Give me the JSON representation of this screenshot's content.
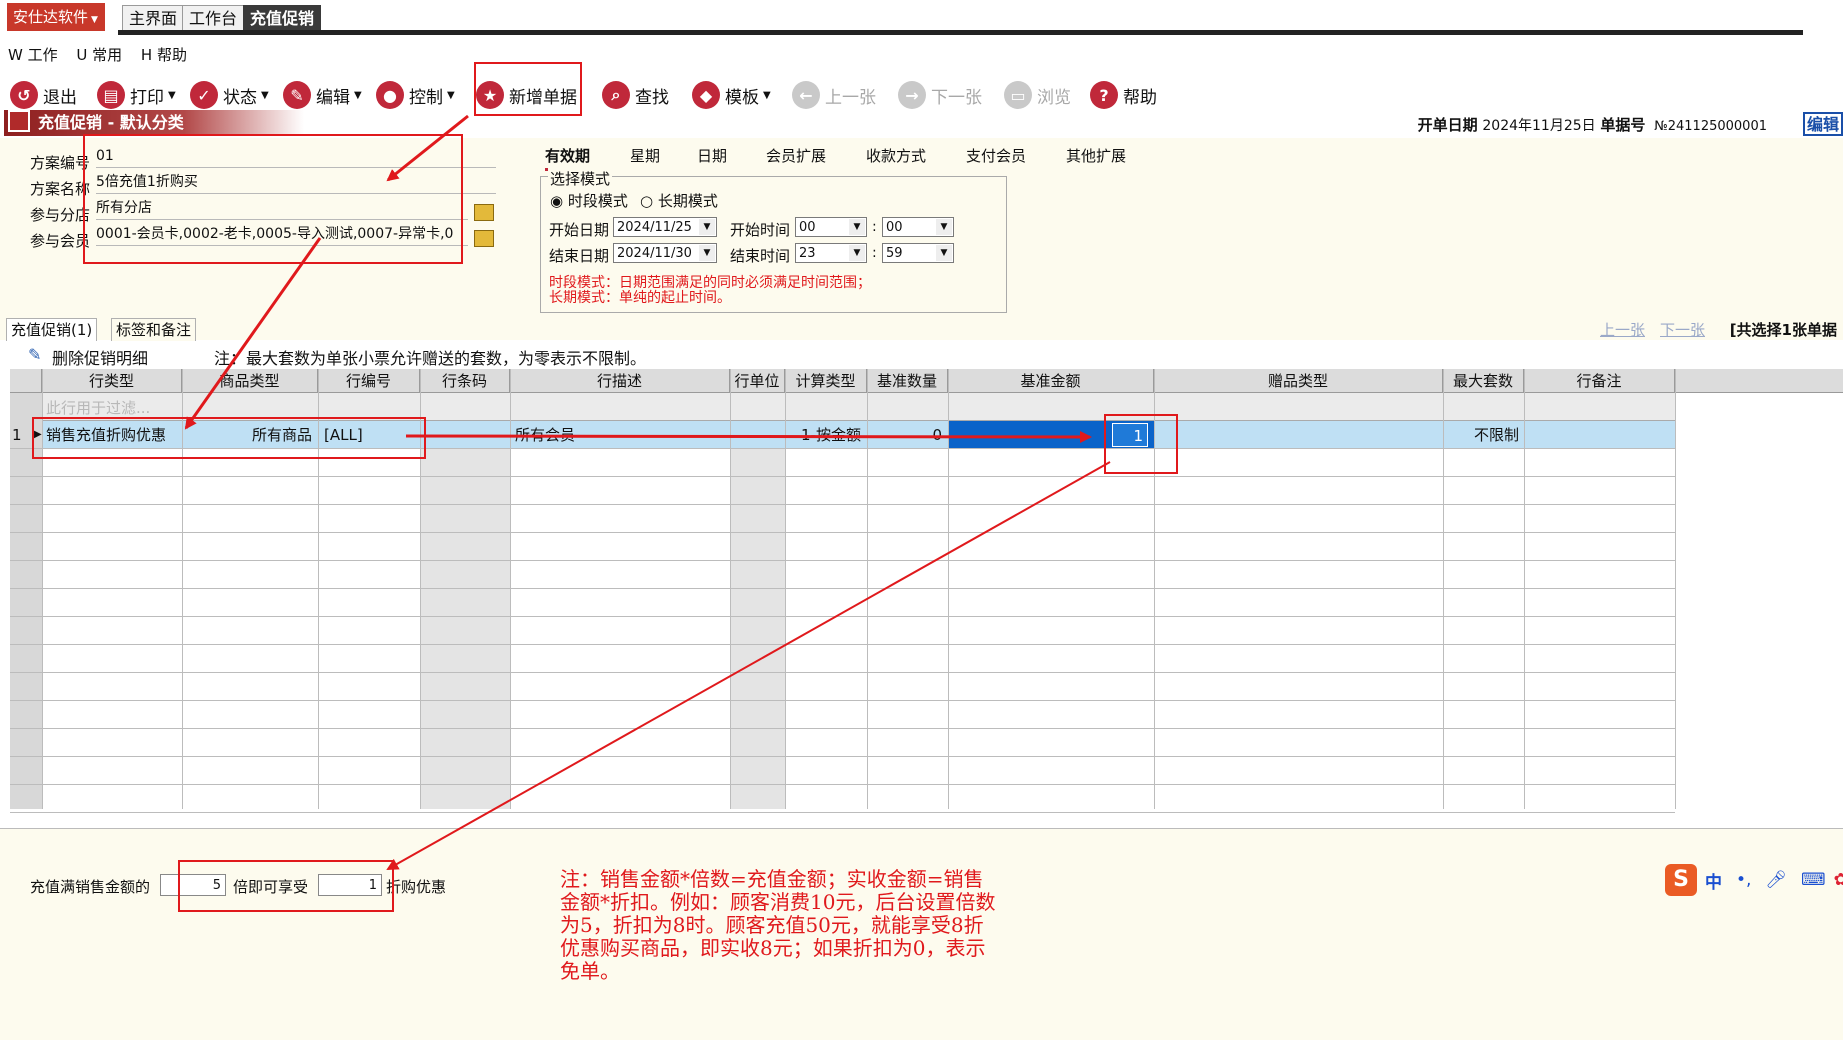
{
  "app": {
    "brand": "安仕达软件",
    "tabs": [
      "主界面",
      "工作台"
    ],
    "active_tab": "充值促销"
  },
  "menu": {
    "items": [
      "W 工作",
      "U 常用",
      "H 帮助"
    ]
  },
  "toolbar": {
    "exit": "退出",
    "print": "打印",
    "status": "状态",
    "edit": "编辑",
    "control": "控制",
    "new_doc": "新增单据",
    "find": "查找",
    "template": "模板",
    "prev": "上一张",
    "next": "下一张",
    "browse": "浏览",
    "help": "帮助"
  },
  "section": {
    "title": "充值促销 - 默认分类"
  },
  "header": {
    "date_label": "开单日期",
    "date_value": "2024年11月25日",
    "no_label": "单据号",
    "no_value": "№241125000001",
    "edit_label": "编辑"
  },
  "form": {
    "plan_no_label": "方案编号",
    "plan_no": "01",
    "plan_name_label": "方案名称",
    "plan_name": "5倍充值1折购买",
    "store_label": "参与分店",
    "store": "所有分店",
    "member_label": "参与会员",
    "member": "0001-会员卡,0002-老卡,0005-导入测试,0007-异常卡,0"
  },
  "rtabs": [
    "有效期",
    "星期",
    "日期",
    "会员扩展",
    "收款方式",
    "支付会员",
    "其他扩展"
  ],
  "mode": {
    "group_title": "选择模式",
    "opt1": "时段模式",
    "opt2": "长期模式",
    "start_date_label": "开始日期",
    "start_date": "2024/11/25",
    "start_time_label": "开始时间",
    "start_h": "00",
    "start_m": "00",
    "end_date_label": "结束日期",
    "end_date": "2024/11/30",
    "end_time_label": "结束时间",
    "end_h": "23",
    "end_m": "59",
    "colon": ":",
    "hint1": "时段模式：日期范围满足的同时必须满足时间范围；",
    "hint2": "长期模式：单纯的起止时间。"
  },
  "detail_tabs": [
    "充值促销(1)",
    "标签和备注"
  ],
  "pager": {
    "prev": "上一张",
    "next": "下一张",
    "total": "[共选择1张单据"
  },
  "notebar": {
    "delete": "删除促销明细",
    "note": "注：最大套数为单张小票允许赠送的套数，为零表示不限制。"
  },
  "grid": {
    "headers": [
      "行类型",
      "商品类型",
      "行编号",
      "行条码",
      "行描述",
      "行单位",
      "计算类型",
      "基准数量",
      "基准金额",
      "赠品类型",
      "最大套数",
      "行备注"
    ],
    "filter_hint": "此行用于过滤...",
    "row1": {
      "no": "1",
      "type": "销售充值折购优惠",
      "goods_type": "所有商品",
      "code": "[ALL]",
      "desc": "所有会员",
      "calc": "1-按金额",
      "base_qty": "0",
      "base_amt": "1",
      "max_sets": "不限制"
    }
  },
  "bottom": {
    "label1": "充值满销售金额的",
    "multiple": "5",
    "label2": "倍即可享受",
    "discount": "1",
    "label3": "折购优惠"
  },
  "note": "注：销售金额*倍数=充值金额；实收金额=销售金额*折扣。例如：顾客消费10元，后台设置倍数为5，折扣为8时。顾客充值50元，就能享受8折优惠购买商品，即实收8元；如果折扣为0，表示免单。",
  "ime": {
    "lang": "中"
  },
  "colors": {
    "brand": "#c8382a",
    "accent": "#c0283a",
    "annotation": "#e0191c",
    "selection": "#0a63c9"
  }
}
